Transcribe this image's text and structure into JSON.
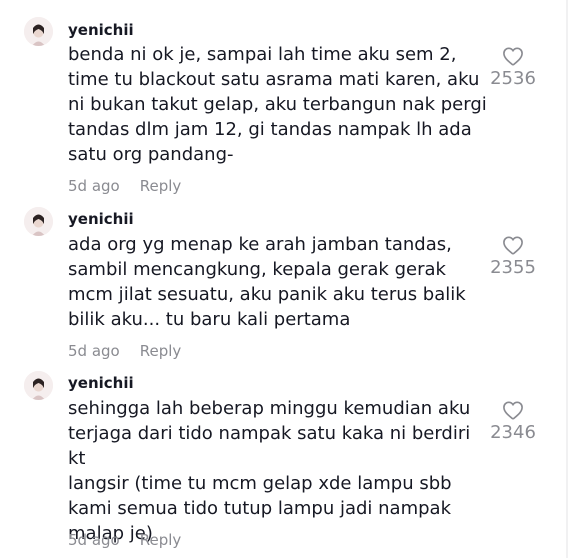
{
  "comments": [
    {
      "username": "yenichii",
      "text": "benda ni ok je, sampai lah time aku sem 2,\ntime tu blackout satu asrama mati karen, aku\nni bukan takut gelap, aku terbangun nak pergi\ntandas dlm jam 12, gi tandas nampak lh ada\nsatu org pandang-",
      "time": "5d ago",
      "reply_label": "Reply",
      "likes": "2536",
      "avatar_icon": "avatar-icon",
      "like_icon": "heart-outline-icon"
    },
    {
      "username": "yenichii",
      "text": "ada org yg menap ke arah jamban tandas,\nsambil mencangkung, kepala gerak gerak\nmcm jilat sesuatu, aku panik aku terus balik\nbilik aku... tu baru kali pertama",
      "time": "5d ago",
      "reply_label": "Reply",
      "likes": "2355",
      "avatar_icon": "avatar-icon",
      "like_icon": "heart-outline-icon"
    },
    {
      "username": "yenichii",
      "text": "sehingga lah beberap minggu kemudian aku\nterjaga dari tido nampak satu kaka ni berdiri kt\nlangsir (time tu mcm gelap xde lampu sbb\nkami semua tido tutup lampu jadi nampak\nmalap je)",
      "time": "5d ago",
      "reply_label": "Reply",
      "likes": "2346",
      "avatar_icon": "avatar-icon",
      "like_icon": "heart-outline-icon"
    }
  ],
  "colors": {
    "text_primary": "#161823",
    "text_secondary": "#8a8b91",
    "background": "#ffffff"
  }
}
